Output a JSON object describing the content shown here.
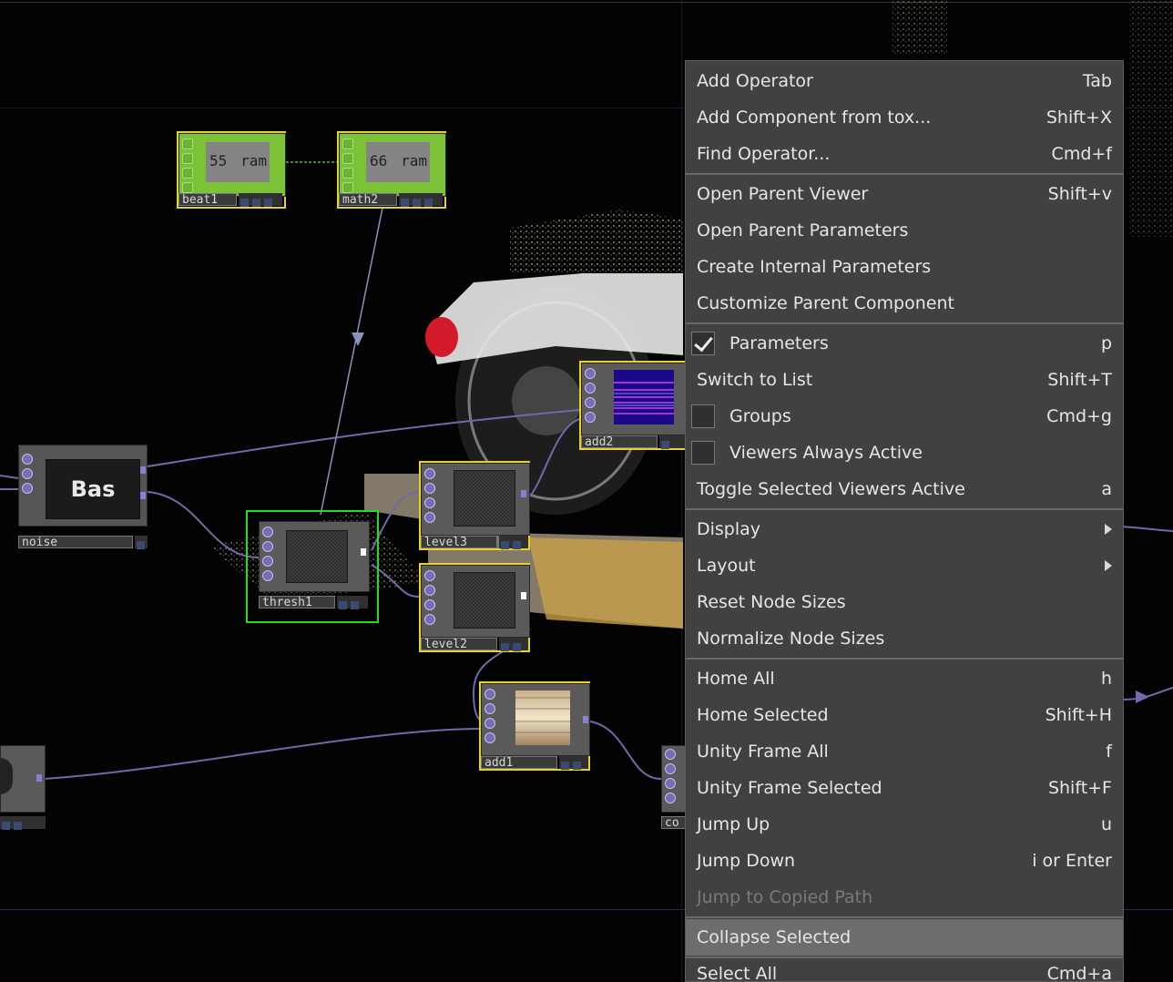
{
  "network": {
    "nodes": {
      "beat1": {
        "label": "beat1",
        "value": "55",
        "suffix": "ram"
      },
      "math2": {
        "label": "math2",
        "value": "66",
        "suffix": "ram"
      },
      "noise": {
        "label": "noise",
        "preview_text": "Bas"
      },
      "thresh1": {
        "label": "thresh1"
      },
      "level3": {
        "label": "level3"
      },
      "level2": {
        "label": "level2"
      },
      "add2": {
        "label": "add2"
      },
      "add1": {
        "label": "add1"
      },
      "partial_node": {
        "label": "co"
      }
    }
  },
  "context_menu": {
    "items": [
      {
        "label": "Add Operator",
        "shortcut": "Tab"
      },
      {
        "label": "Add Component from tox...",
        "shortcut": "Shift+X"
      },
      {
        "label": "Find Operator...",
        "shortcut": "Cmd+f"
      },
      {
        "label": "Open Parent Viewer",
        "shortcut": "Shift+v"
      },
      {
        "label": "Open Parent Parameters",
        "shortcut": ""
      },
      {
        "label": "Create Internal Parameters",
        "shortcut": ""
      },
      {
        "label": "Customize Parent Component",
        "shortcut": ""
      },
      {
        "label": "Parameters",
        "shortcut": "p",
        "checked": true
      },
      {
        "label": "Switch to List",
        "shortcut": "Shift+T"
      },
      {
        "label": "Groups",
        "shortcut": "Cmd+g",
        "checked": false
      },
      {
        "label": "Viewers Always Active",
        "shortcut": "",
        "checked": false
      },
      {
        "label": "Toggle Selected Viewers Active",
        "shortcut": "a"
      },
      {
        "label": "Display",
        "shortcut": ""
      },
      {
        "label": "Layout",
        "shortcut": ""
      },
      {
        "label": "Reset Node Sizes",
        "shortcut": ""
      },
      {
        "label": "Normalize Node Sizes",
        "shortcut": ""
      },
      {
        "label": "Home All",
        "shortcut": "h"
      },
      {
        "label": "Home Selected",
        "shortcut": "Shift+H"
      },
      {
        "label": "Unity Frame All",
        "shortcut": "f"
      },
      {
        "label": "Unity Frame Selected",
        "shortcut": "Shift+F"
      },
      {
        "label": "Jump Up",
        "shortcut": "u"
      },
      {
        "label": "Jump Down",
        "shortcut": "i or Enter"
      },
      {
        "label": "Jump to Copied Path",
        "shortcut": ""
      },
      {
        "label": "Collapse Selected",
        "shortcut": ""
      },
      {
        "label": "Select All",
        "shortcut": "Cmd+a"
      }
    ]
  },
  "colors": {
    "menu_bg": "#414141",
    "menu_highlight": "#6d6d6d",
    "selection_yellow": "#e8d22a",
    "selection_green": "#22dd22",
    "wire": "#6f6aa8",
    "chop_green": "#66b43a",
    "top_purple": "#7a6cb4"
  }
}
